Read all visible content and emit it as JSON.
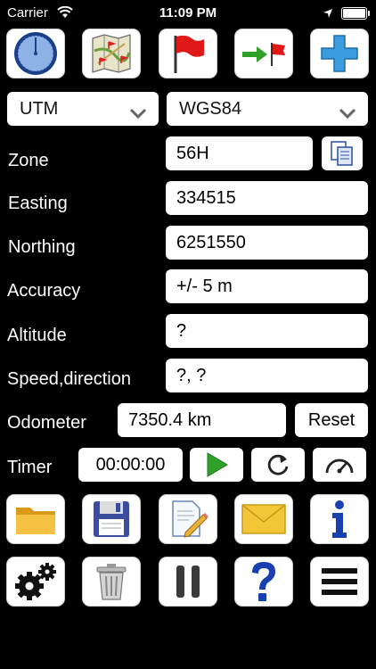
{
  "status_bar": {
    "carrier": "Carrier",
    "time": "11:09 PM"
  },
  "toolbar_top": [
    {
      "icon": "compass-icon"
    },
    {
      "icon": "map-icon"
    },
    {
      "icon": "red-flag-icon"
    },
    {
      "icon": "navigate-to-flag-icon"
    },
    {
      "icon": "plus-icon"
    }
  ],
  "coord_format": {
    "selected": "UTM"
  },
  "datum": {
    "selected": "WGS84"
  },
  "fields": {
    "zone_label": "Zone",
    "zone_value": "56H",
    "easting_label": "Easting",
    "easting_value": "334515",
    "northing_label": "Northing",
    "northing_value": "6251550",
    "accuracy_label": "Accuracy",
    "accuracy_value": "+/- 5 m",
    "altitude_label": "Altitude",
    "altitude_value": "?",
    "speed_label": "Speed,direction",
    "speed_value": "?, ?",
    "odometer_label": "Odometer",
    "odometer_value": "7350.4 km",
    "reset_label": "Reset",
    "timer_label": "Timer",
    "timer_value": "00:00:00"
  },
  "toolbar_bottom_row1": [
    {
      "icon": "folder-icon"
    },
    {
      "icon": "floppy-disk-icon"
    },
    {
      "icon": "edit-document-icon"
    },
    {
      "icon": "envelope-icon"
    },
    {
      "icon": "info-icon"
    }
  ],
  "toolbar_bottom_row2": [
    {
      "icon": "gears-icon"
    },
    {
      "icon": "trash-icon"
    },
    {
      "icon": "pause-icon"
    },
    {
      "icon": "help-icon"
    },
    {
      "icon": "menu-icon"
    }
  ],
  "colors": {
    "accent_blue": "#1a5fc4",
    "flag_red": "#e01818",
    "play_green": "#2fa12a"
  }
}
